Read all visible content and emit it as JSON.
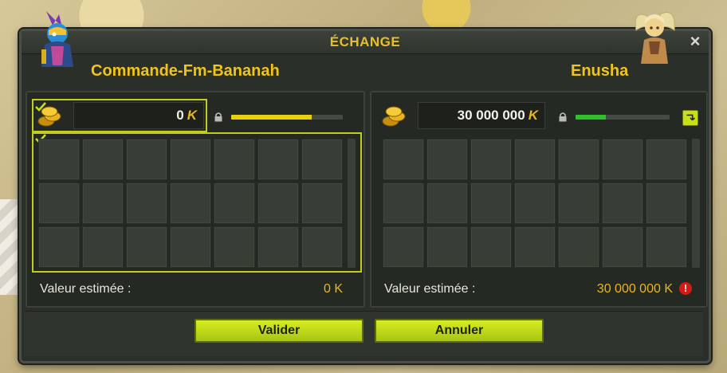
{
  "window": {
    "title": "ÉCHANGE",
    "close_glyph": "×"
  },
  "left_player": {
    "name": "Commande-Fm-Bananah",
    "kamas": "0",
    "kamas_symbol": "K",
    "estimated_label": "Valeur estimée :",
    "estimated_value": "0 K",
    "bar_fill": 0.72,
    "bar_color": "#e8d010",
    "validated": true
  },
  "right_player": {
    "name": "Enusha",
    "kamas": "30 000 000",
    "kamas_symbol": "K",
    "estimated_label": "Valeur estimée :",
    "estimated_value": "30 000 000 K",
    "warning_glyph": "!",
    "bar_fill": 0.32,
    "bar_color": "#2fc02a"
  },
  "buttons": {
    "validate": "Valider",
    "cancel": "Annuler"
  },
  "icons": {
    "coins": "kamas-coins-icon",
    "lock": "lock-icon",
    "check": "check-icon",
    "warning": "warning-icon",
    "close": "close-icon"
  },
  "colors": {
    "accent": "#f0c419",
    "button": "#c3dc1a",
    "selection": "#c3cc1c"
  }
}
